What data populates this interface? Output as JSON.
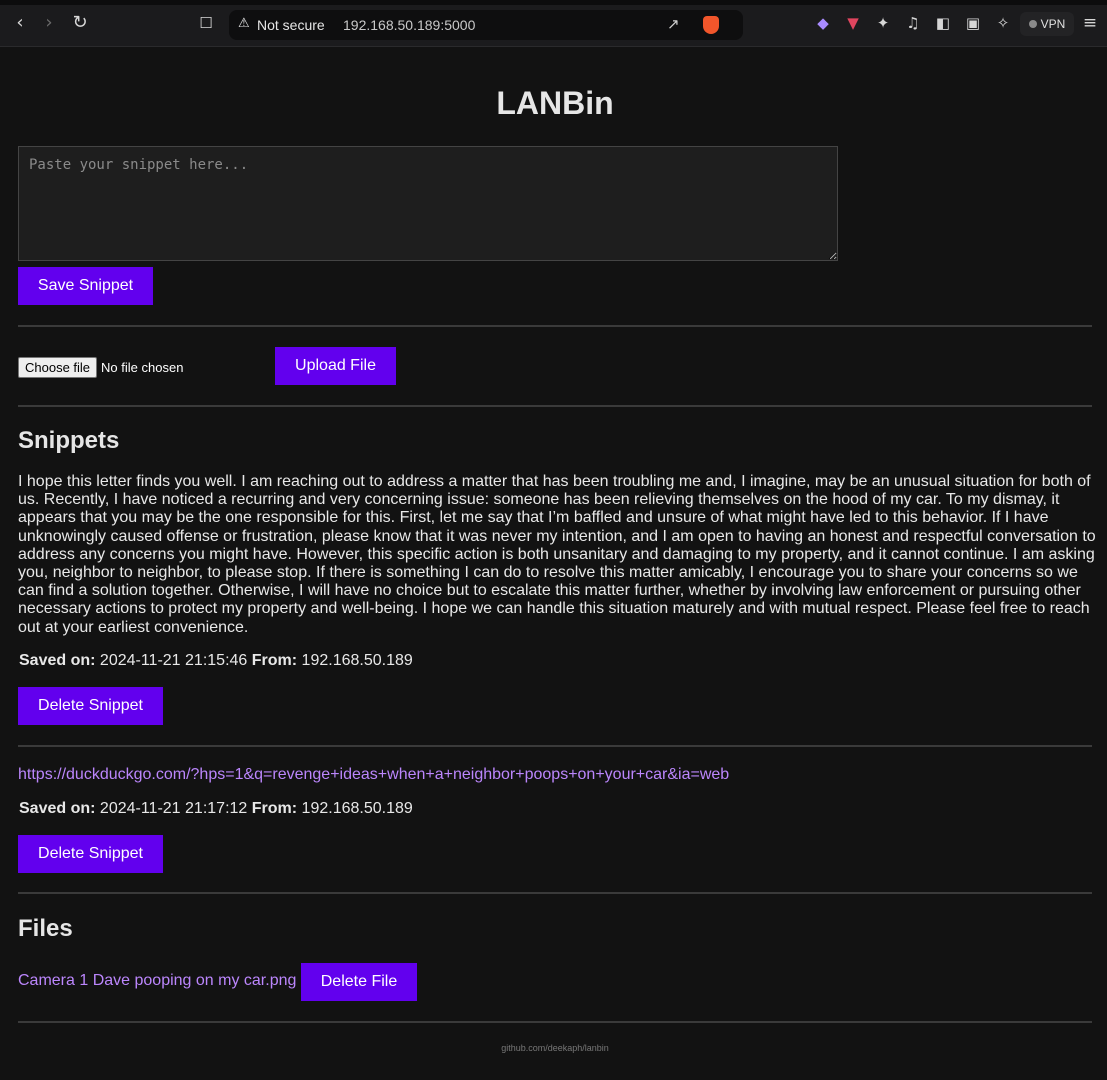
{
  "browser": {
    "security_label": "Not secure",
    "url": "192.168.50.189:5000",
    "vpn_label": "VPN"
  },
  "app": {
    "title": "LANBin"
  },
  "editor": {
    "placeholder": "Paste your snippet here...",
    "save_label": "Save Snippet"
  },
  "upload": {
    "choose_label": "Choose file",
    "no_file_label": "No file chosen",
    "upload_label": "Upload File"
  },
  "snippets": {
    "heading": "Snippets",
    "saved_on_label": "Saved on:",
    "from_label": "From:",
    "delete_label": "Delete Snippet",
    "items": [
      {
        "text": "I hope this letter finds you well. I am reaching out to address a matter that has been troubling me and, I imagine, may be an unusual situation for both of us. Recently, I have noticed a recurring and very concerning issue: someone has been relieving themselves on the hood of my car. To my dismay, it appears that you may be the one responsible for this. First, let me say that I’m baffled and unsure of what might have led to this behavior. If I have unknowingly caused offense or frustration, please know that it was never my intention, and I am open to having an honest and respectful conversation to address any concerns you might have. However, this specific action is both unsanitary and damaging to my property, and it cannot continue. I am asking you, neighbor to neighbor, to please stop. If there is something I can do to resolve this matter amicably, I encourage you to share your concerns so we can find a solution together. Otherwise, I will have no choice but to escalate this matter further, whether by involving law enforcement or pursuing other necessary actions to protect my property and well-being. I hope we can handle this situation maturely and with mutual respect. Please feel free to reach out at your earliest convenience.",
        "saved_on": "2024-11-21 21:15:46",
        "from": "192.168.50.189"
      },
      {
        "text": "https://duckduckgo.com/?hps=1&q=revenge+ideas+when+a+neighbor+poops+on+your+car&ia=web",
        "saved_on": "2024-11-21 21:17:12",
        "from": "192.168.50.189"
      }
    ]
  },
  "files": {
    "heading": "Files",
    "delete_label": "Delete File",
    "items": [
      {
        "name": "Camera 1 Dave pooping on my car.png"
      }
    ]
  },
  "footer": {
    "text": "github.com/deekaph/lanbin"
  }
}
